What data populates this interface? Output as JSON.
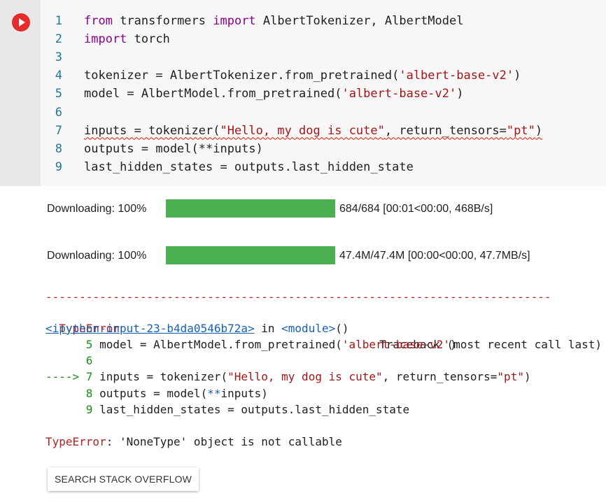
{
  "code_cell": {
    "run_icon": "play-circle-icon",
    "lines": [
      {
        "num": "1",
        "parts": [
          [
            "kw",
            "from"
          ],
          [
            "t",
            " transformers "
          ],
          [
            "kw",
            "import"
          ],
          [
            "t",
            " AlbertTokenizer, AlbertModel"
          ]
        ]
      },
      {
        "num": "2",
        "parts": [
          [
            "kw",
            "import"
          ],
          [
            "t",
            " torch"
          ]
        ]
      },
      {
        "num": "3",
        "parts": []
      },
      {
        "num": "4",
        "parts": [
          [
            "t",
            "tokenizer = AlbertTokenizer.from_pretrained("
          ],
          [
            "str",
            "'albert-base-v2'"
          ],
          [
            "t",
            ")"
          ]
        ]
      },
      {
        "num": "5",
        "parts": [
          [
            "t",
            "model = AlbertModel.from_pretrained("
          ],
          [
            "str",
            "'albert-base-v2'"
          ],
          [
            "t",
            ")"
          ]
        ]
      },
      {
        "num": "6",
        "parts": []
      },
      {
        "num": "7",
        "squiggle": true,
        "parts": [
          [
            "t",
            "inputs = tokenizer("
          ],
          [
            "str",
            "\"Hello, my dog is cute\""
          ],
          [
            "t",
            ", return_tensors="
          ],
          [
            "str",
            "\"pt\""
          ],
          [
            "t",
            ")"
          ]
        ]
      },
      {
        "num": "8",
        "parts": [
          [
            "t",
            "outputs = model(**inputs)"
          ]
        ]
      },
      {
        "num": "9",
        "parts": [
          [
            "t",
            "last_hidden_states = outputs.last_hidden_state"
          ]
        ]
      }
    ]
  },
  "downloads": [
    {
      "label": "Downloading: 100%",
      "progress": 1.0,
      "stats": "684/684 [00:01<00:00, 468B/s]"
    },
    {
      "label": "Downloading: 100%",
      "progress": 1.0,
      "stats": "47.4M/47.4M [00:00<00:00, 47.7MB/s]"
    }
  ],
  "traceback": {
    "dashes": "---------------------------------------------------------------------------",
    "error_type": "TypeError",
    "header_right": "Traceback (most recent call last)",
    "input_link": "<ipython-input-23-b4da0546b72a>",
    "in_text": " in ",
    "module": "<module>",
    "module_suffix": "()",
    "lines": [
      {
        "prefix": "      ",
        "num": "5",
        "parts": [
          [
            "t",
            " model = AlbertModel.from_pretrained("
          ],
          [
            "str",
            "'albert-base-v2'"
          ],
          [
            "t",
            ")"
          ]
        ]
      },
      {
        "prefix": "      ",
        "num": "6",
        "parts": []
      },
      {
        "prefix": "----> ",
        "num": "7",
        "parts": [
          [
            "t",
            " inputs = tokenizer("
          ],
          [
            "str",
            "\"Hello, my dog is cute\""
          ],
          [
            "t",
            ", return_tensors="
          ],
          [
            "str",
            "\"pt\""
          ],
          [
            "t",
            ")"
          ]
        ]
      },
      {
        "prefix": "      ",
        "num": "8",
        "parts": [
          [
            "t",
            " outputs = model("
          ],
          [
            "blue",
            "**"
          ],
          [
            "t",
            "inputs)"
          ]
        ]
      },
      {
        "prefix": "      ",
        "num": "9",
        "parts": [
          [
            "t",
            " last_hidden_states = outputs.last_hidden_state"
          ]
        ]
      }
    ],
    "final_error_type": "TypeError",
    "final_message": ": 'NoneType' object is not callable"
  },
  "search_button_label": "SEARCH STACK OVERFLOW",
  "colors": {
    "progress": "#4caf50",
    "run": "#e62b2b",
    "error": "#b22222"
  }
}
